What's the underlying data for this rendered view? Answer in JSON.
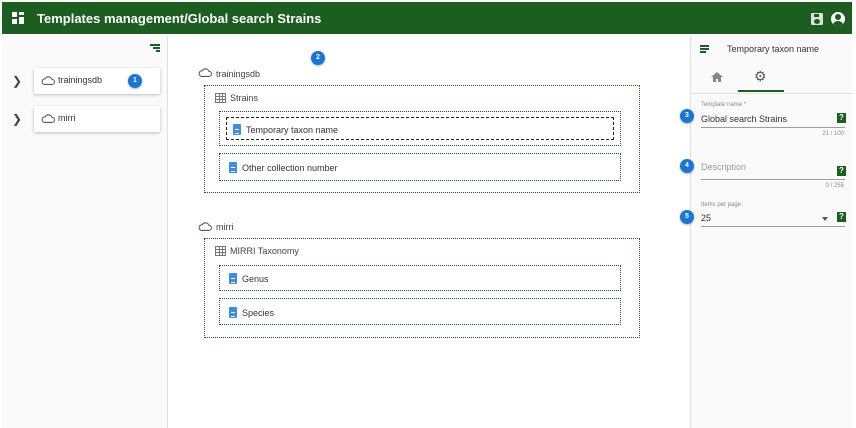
{
  "header": {
    "title": "Templates management/Global search Strains"
  },
  "left_panel": {
    "databases": [
      {
        "name": "trainingsdb",
        "badge": "1"
      },
      {
        "name": "mirri"
      }
    ]
  },
  "canvas": {
    "badge": "2",
    "databases": [
      {
        "name": "trainingsdb",
        "table": "Strains",
        "fields": [
          "Temporary taxon name",
          "Other collection number"
        ]
      },
      {
        "name": "mirri",
        "table": "MIRRI Taxonomy",
        "fields": [
          "Genus",
          "Species"
        ]
      }
    ]
  },
  "right_panel": {
    "title": "Temporary taxon name",
    "tabs": [
      {
        "icon": "home-icon"
      },
      {
        "icon": "gear-icon",
        "active": true
      }
    ],
    "fields": {
      "template_name": {
        "caption": "Template name *",
        "value": "Global search Strains",
        "counter": "21 / 100",
        "badge": "3"
      },
      "description": {
        "placeholder": "Description",
        "counter": "0 / 255",
        "badge": "4"
      },
      "items_per_page": {
        "caption": "Items per page",
        "value": "25",
        "badge": "5"
      }
    },
    "help_symbol": "?"
  },
  "colors": {
    "header_bg": "#1b5e20",
    "badge": "#1976d2",
    "doc_icon": "#3f8de0",
    "border_green": "#1b5e20"
  }
}
